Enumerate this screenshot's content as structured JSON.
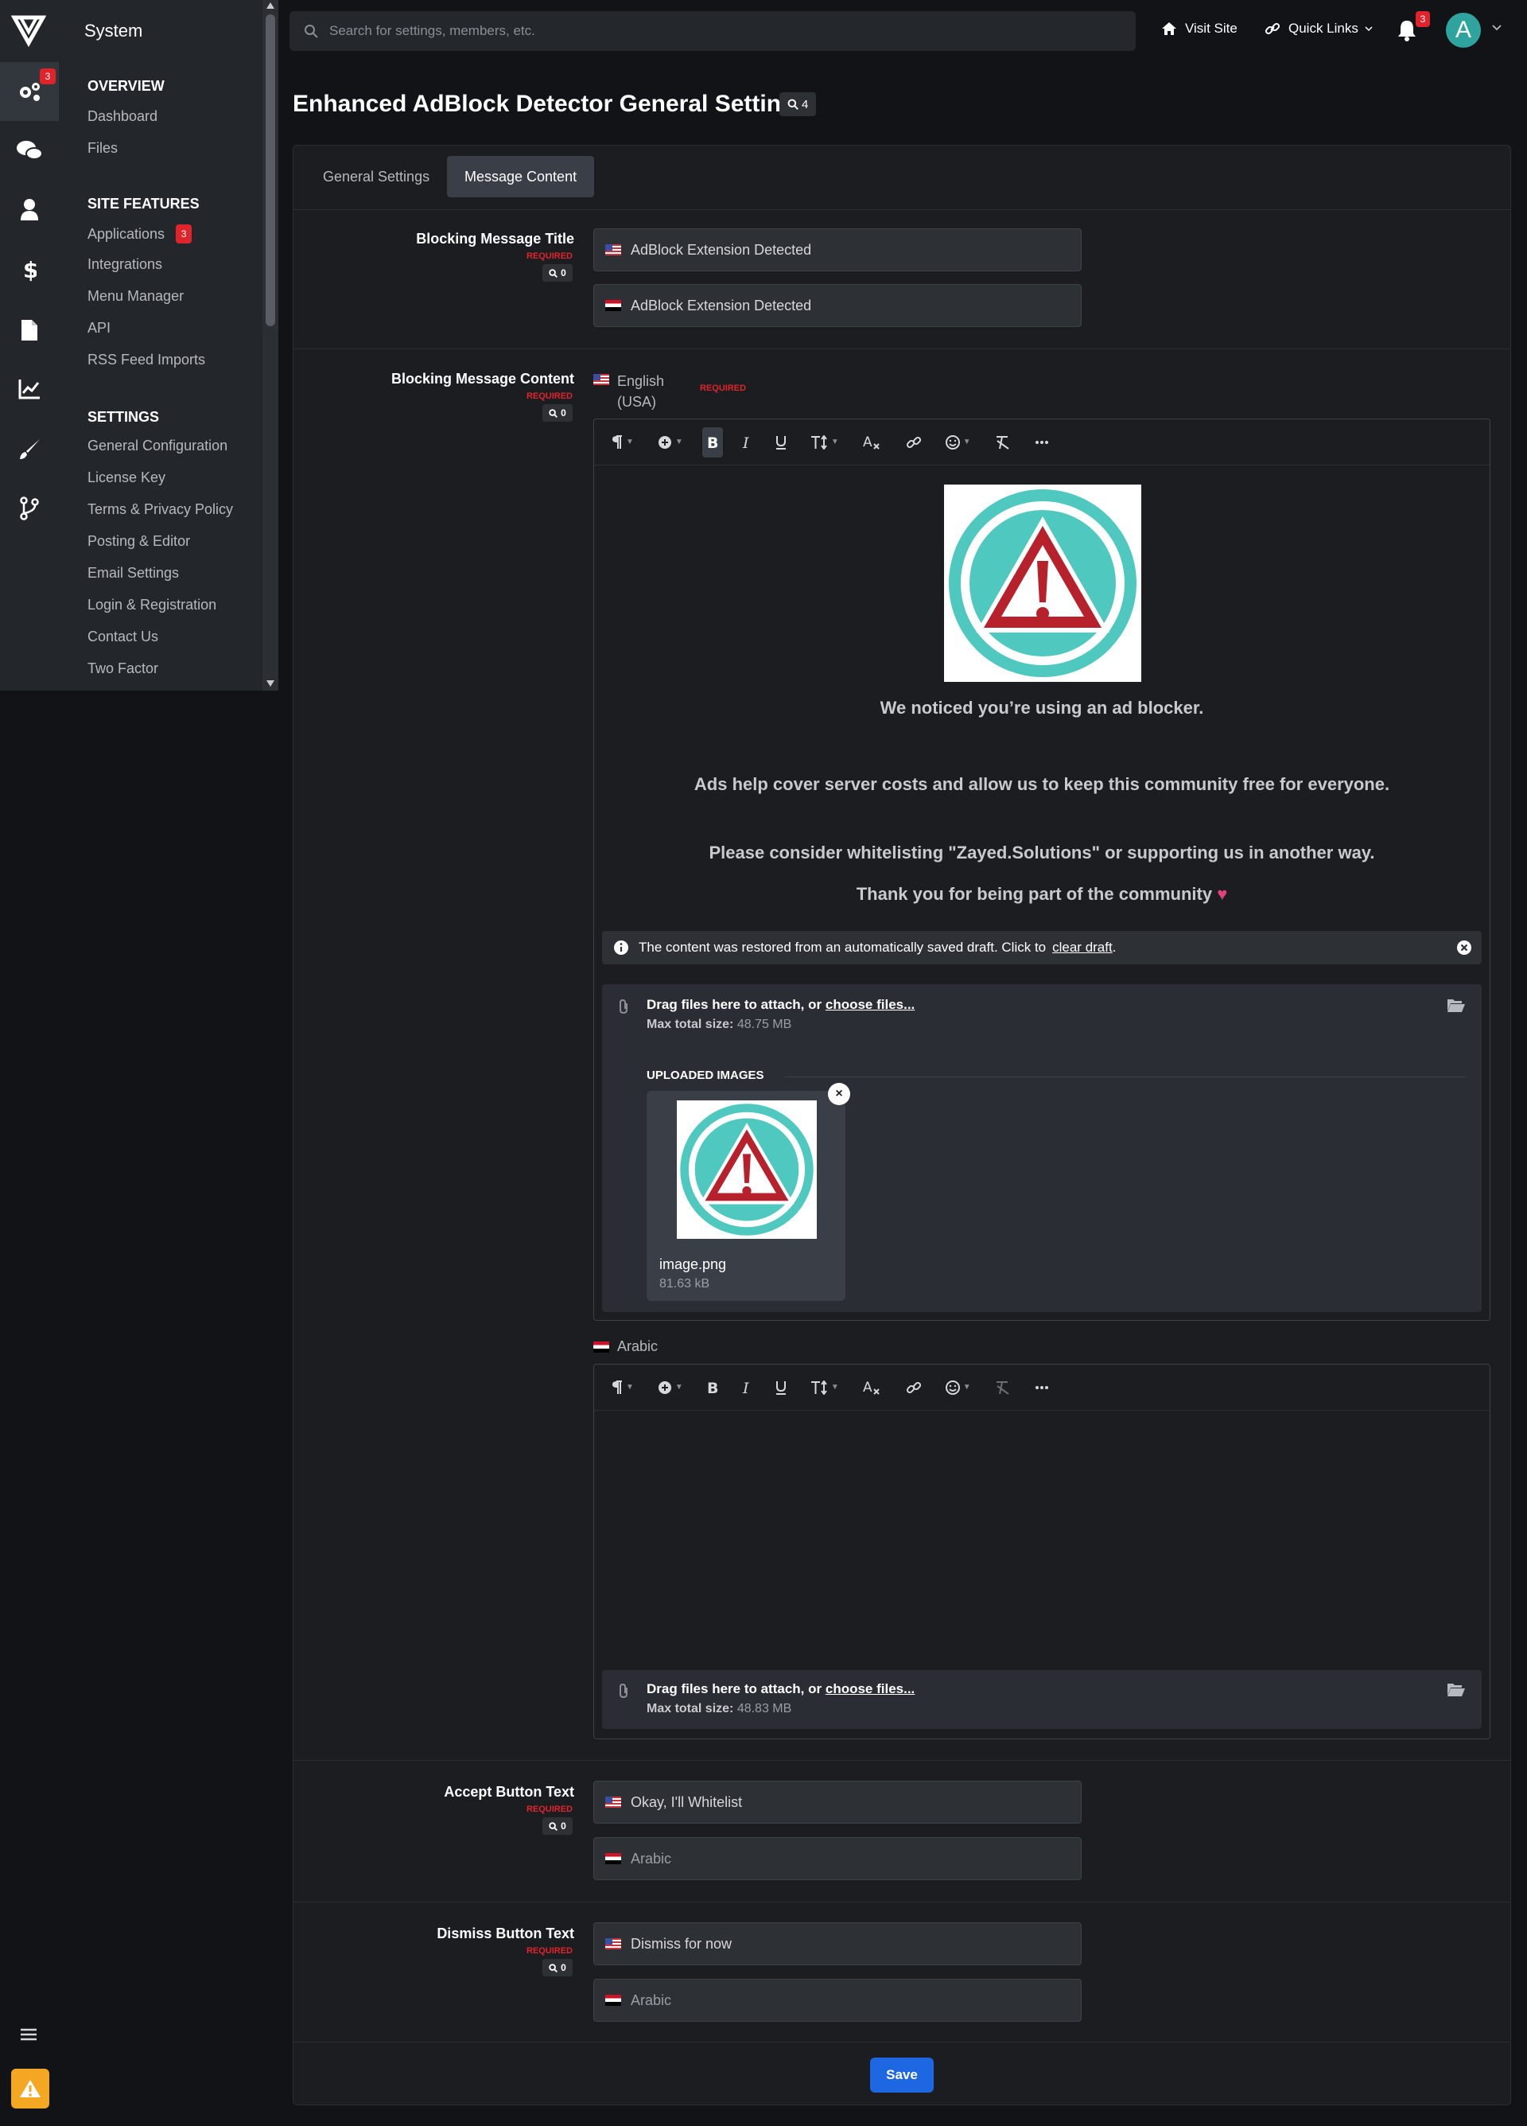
{
  "sidebar": {
    "title": "System",
    "settings_badge": "3",
    "sections": [
      {
        "heading": "OVERVIEW",
        "items": [
          "Dashboard",
          "Files"
        ]
      },
      {
        "heading": "SITE FEATURES",
        "items": [
          "Applications",
          "Integrations",
          "Menu Manager",
          "API",
          "RSS Feed Imports"
        ],
        "applications_badge": "3"
      },
      {
        "heading": "SETTINGS",
        "items": [
          "General Configuration",
          "License Key",
          "Terms & Privacy Policy",
          "Posting & Editor",
          "Email Settings",
          "Login & Registration",
          "Contact Us",
          "Two Factor"
        ]
      }
    ],
    "icons": [
      "settings-icon",
      "chat-icon",
      "user-icon",
      "dollar-icon",
      "file-icon",
      "chart-icon",
      "brush-icon",
      "branch-icon"
    ]
  },
  "header": {
    "search_placeholder": "Search for settings, members, etc.",
    "visit_site": "Visit Site",
    "quick_links": "Quick Links",
    "notifications_badge": "3",
    "avatar_letter": "A"
  },
  "page": {
    "title": "Enhanced AdBlock Detector General Settings",
    "search_count": "4",
    "tabs": [
      "General Settings",
      "Message Content"
    ],
    "active_tab": "Message Content"
  },
  "fields": {
    "required_label": "REQUIRED",
    "search_count": "0",
    "title": {
      "label": "Blocking Message Title",
      "en_value": "AdBlock Extension Detected",
      "ar_value": "AdBlock Extension Detected"
    },
    "content": {
      "label": "Blocking Message Content",
      "lang_en": "English (USA)",
      "lang_ar": "Arabic",
      "lines": [
        "We noticed you’re using an ad blocker.",
        "Ads help cover server costs and allow us to keep this community free for everyone.",
        "Please consider whitelisting \"Zayed.Solutions\" or supporting us in another way.",
        "Thank you for being part of the community"
      ],
      "draft_notice": "The content was restored from an automatically saved draft. Click to",
      "draft_link": "clear draft",
      "attach_text": "Drag files here to attach, or",
      "attach_link": "choose files...",
      "max_label": "Max total size:",
      "max_en": "48.75 MB",
      "max_ar": "48.83 MB",
      "uploaded_heading": "UPLOADED IMAGES",
      "upload": {
        "name": "image.png",
        "size": "81.63 kB"
      }
    },
    "accept": {
      "label": "Accept Button Text",
      "en_value": "Okay, I'll Whitelist",
      "ar_placeholder": "Arabic"
    },
    "dismiss": {
      "label": "Dismiss Button Text",
      "en_value": "Dismiss for now",
      "ar_placeholder": "Arabic"
    }
  },
  "save_label": "Save",
  "colors": {
    "accent": "#1e67e3",
    "badge": "#e0242c",
    "warning": "#f4a722",
    "avatar": "#2fa39e"
  }
}
